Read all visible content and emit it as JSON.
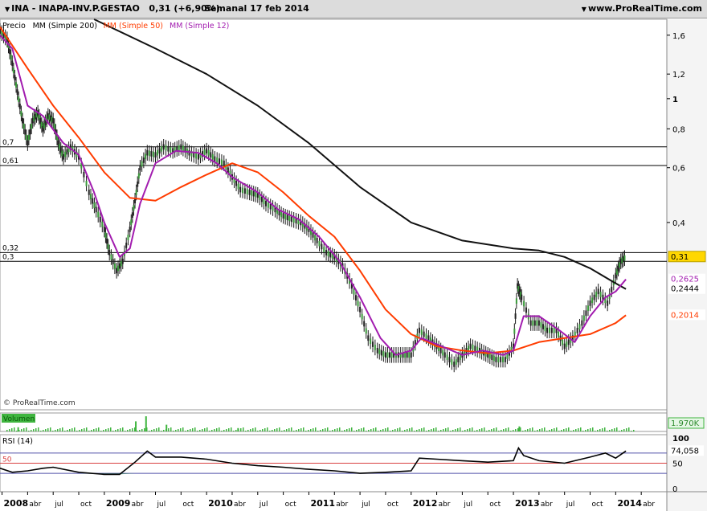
{
  "header": {
    "symbol": "INA - INAPA-INV.P.GESTAO",
    "price_change": "0,31 (+6,90%)",
    "period_date": "Semanal  17 feb 2014",
    "site": "www.ProRealTime.com"
  },
  "legend": {
    "price": "Precio",
    "ma200": "MM (Simple 200)",
    "ma50": "MM (Simple 50)",
    "ma12": "MM (Simple 12)"
  },
  "colors": {
    "price": "#1a1a1a",
    "ma200": "#111111",
    "ma50": "#ff3c00",
    "ma12": "#a21caf",
    "volume": "#3fb53f",
    "rsi_line": "#000000",
    "rsi_fill": "#1e7b3a",
    "level_line": "#000000",
    "rsi_mid": "#d94040",
    "rsi_band": "#5555aa",
    "badge_price": "#ffd700"
  },
  "watermark": "© ProRealTime.com",
  "chart_data": [
    {
      "type": "line",
      "title": "INA - INAPA-INV.P.GESTAO",
      "scale": "log",
      "ylim": [
        0.1,
        1.8
      ],
      "y_ticks": [
        "0,4",
        "0,6",
        "0,8",
        "1",
        "1,2",
        "1,6"
      ],
      "y_tick_values": [
        0.4,
        0.6,
        0.8,
        1.0,
        1.2,
        1.6
      ],
      "x": [
        "2008",
        "abr",
        "jul",
        "oct",
        "2009",
        "abr",
        "jul",
        "oct",
        "2010",
        "abr",
        "jul",
        "oct",
        "2011",
        "abr",
        "jul",
        "oct",
        "2012",
        "abr",
        "jul",
        "oct",
        "2013",
        "abr",
        "jul",
        "oct",
        "2014",
        "abr"
      ],
      "x_numeric": [
        2008.0,
        2008.25,
        2008.5,
        2008.75,
        2009.0,
        2009.25,
        2009.5,
        2009.75,
        2010.0,
        2010.25,
        2010.5,
        2010.75,
        2011.0,
        2011.25,
        2011.5,
        2011.75,
        2012.0,
        2012.25,
        2012.5,
        2012.75,
        2013.0,
        2013.25,
        2013.5,
        2013.75,
        2014.0,
        2014.25
      ],
      "xlim": [
        2007.98,
        2014.5
      ],
      "levels": [
        {
          "label": "0,7",
          "value": 0.7
        },
        {
          "label": "0,61",
          "value": 0.61
        },
        {
          "label": "0,32",
          "value": 0.32
        },
        {
          "label": "0,3",
          "value": 0.3
        }
      ],
      "series": [
        {
          "name": "Precio",
          "points": [
            [
              2007.98,
              1.65
            ],
            [
              2008.05,
              1.55
            ],
            [
              2008.1,
              1.3
            ],
            [
              2008.15,
              1.05
            ],
            [
              2008.2,
              0.85
            ],
            [
              2008.25,
              0.72
            ],
            [
              2008.3,
              0.85
            ],
            [
              2008.35,
              0.9
            ],
            [
              2008.4,
              0.8
            ],
            [
              2008.45,
              0.88
            ],
            [
              2008.5,
              0.85
            ],
            [
              2008.55,
              0.72
            ],
            [
              2008.6,
              0.65
            ],
            [
              2008.67,
              0.7
            ],
            [
              2008.75,
              0.65
            ],
            [
              2008.85,
              0.5
            ],
            [
              2008.92,
              0.44
            ],
            [
              2009.0,
              0.38
            ],
            [
              2009.05,
              0.32
            ],
            [
              2009.12,
              0.28
            ],
            [
              2009.18,
              0.3
            ],
            [
              2009.25,
              0.38
            ],
            [
              2009.3,
              0.47
            ],
            [
              2009.35,
              0.6
            ],
            [
              2009.42,
              0.67
            ],
            [
              2009.5,
              0.66
            ],
            [
              2009.58,
              0.7
            ],
            [
              2009.67,
              0.68
            ],
            [
              2009.75,
              0.7
            ],
            [
              2009.83,
              0.67
            ],
            [
              2009.92,
              0.65
            ],
            [
              2010.0,
              0.68
            ],
            [
              2010.08,
              0.64
            ],
            [
              2010.17,
              0.62
            ],
            [
              2010.25,
              0.56
            ],
            [
              2010.33,
              0.51
            ],
            [
              2010.42,
              0.5
            ],
            [
              2010.5,
              0.49
            ],
            [
              2010.58,
              0.46
            ],
            [
              2010.67,
              0.44
            ],
            [
              2010.75,
              0.42
            ],
            [
              2010.83,
              0.41
            ],
            [
              2010.92,
              0.4
            ],
            [
              2011.0,
              0.38
            ],
            [
              2011.08,
              0.35
            ],
            [
              2011.17,
              0.32
            ],
            [
              2011.25,
              0.31
            ],
            [
              2011.33,
              0.29
            ],
            [
              2011.42,
              0.25
            ],
            [
              2011.5,
              0.21
            ],
            [
              2011.58,
              0.17
            ],
            [
              2011.67,
              0.155
            ],
            [
              2011.75,
              0.15
            ],
            [
              2011.83,
              0.15
            ],
            [
              2011.92,
              0.15
            ],
            [
              2012.0,
              0.15
            ],
            [
              2012.08,
              0.18
            ],
            [
              2012.17,
              0.17
            ],
            [
              2012.25,
              0.16
            ],
            [
              2012.33,
              0.15
            ],
            [
              2012.42,
              0.14
            ],
            [
              2012.5,
              0.15
            ],
            [
              2012.58,
              0.16
            ],
            [
              2012.67,
              0.155
            ],
            [
              2012.75,
              0.15
            ],
            [
              2012.83,
              0.145
            ],
            [
              2012.92,
              0.145
            ],
            [
              2013.0,
              0.16
            ],
            [
              2013.04,
              0.25
            ],
            [
              2013.08,
              0.23
            ],
            [
              2013.17,
              0.19
            ],
            [
              2013.25,
              0.19
            ],
            [
              2013.33,
              0.18
            ],
            [
              2013.42,
              0.18
            ],
            [
              2013.5,
              0.16
            ],
            [
              2013.58,
              0.17
            ],
            [
              2013.67,
              0.19
            ],
            [
              2013.75,
              0.22
            ],
            [
              2013.83,
              0.24
            ],
            [
              2013.92,
              0.22
            ],
            [
              2014.0,
              0.27
            ],
            [
              2014.05,
              0.3
            ],
            [
              2014.1,
              0.31
            ]
          ]
        },
        {
          "name": "MM (Simple 200)",
          "points": [
            [
              2008.9,
              1.8
            ],
            [
              2009.5,
              1.45
            ],
            [
              2010.0,
              1.2
            ],
            [
              2010.5,
              0.95
            ],
            [
              2011.0,
              0.72
            ],
            [
              2011.5,
              0.52
            ],
            [
              2012.0,
              0.4
            ],
            [
              2012.5,
              0.35
            ],
            [
              2013.0,
              0.33
            ],
            [
              2013.25,
              0.325
            ],
            [
              2013.5,
              0.31
            ],
            [
              2013.75,
              0.285
            ],
            [
              2014.0,
              0.255
            ],
            [
              2014.1,
              0.2444
            ]
          ]
        },
        {
          "name": "MM (Simple 50)",
          "points": [
            [
              2007.98,
              1.7
            ],
            [
              2008.25,
              1.25
            ],
            [
              2008.5,
              0.95
            ],
            [
              2008.75,
              0.75
            ],
            [
              2009.0,
              0.58
            ],
            [
              2009.25,
              0.48
            ],
            [
              2009.5,
              0.47
            ],
            [
              2009.75,
              0.52
            ],
            [
              2010.0,
              0.57
            ],
            [
              2010.25,
              0.62
            ],
            [
              2010.5,
              0.58
            ],
            [
              2010.75,
              0.5
            ],
            [
              2011.0,
              0.42
            ],
            [
              2011.25,
              0.36
            ],
            [
              2011.5,
              0.28
            ],
            [
              2011.75,
              0.21
            ],
            [
              2012.0,
              0.175
            ],
            [
              2012.25,
              0.16
            ],
            [
              2012.5,
              0.155
            ],
            [
              2012.75,
              0.152
            ],
            [
              2013.0,
              0.155
            ],
            [
              2013.25,
              0.165
            ],
            [
              2013.5,
              0.17
            ],
            [
              2013.75,
              0.175
            ],
            [
              2014.0,
              0.19
            ],
            [
              2014.1,
              0.2014
            ]
          ]
        },
        {
          "name": "MM (Simple 12)",
          "points": [
            [
              2007.98,
              1.6
            ],
            [
              2008.1,
              1.45
            ],
            [
              2008.25,
              0.95
            ],
            [
              2008.4,
              0.88
            ],
            [
              2008.6,
              0.72
            ],
            [
              2008.75,
              0.66
            ],
            [
              2008.9,
              0.5
            ],
            [
              2009.0,
              0.4
            ],
            [
              2009.15,
              0.31
            ],
            [
              2009.25,
              0.33
            ],
            [
              2009.35,
              0.46
            ],
            [
              2009.5,
              0.62
            ],
            [
              2009.7,
              0.68
            ],
            [
              2009.92,
              0.67
            ],
            [
              2010.1,
              0.62
            ],
            [
              2010.25,
              0.56
            ],
            [
              2010.5,
              0.5
            ],
            [
              2010.7,
              0.44
            ],
            [
              2010.9,
              0.41
            ],
            [
              2011.1,
              0.36
            ],
            [
              2011.3,
              0.3
            ],
            [
              2011.5,
              0.23
            ],
            [
              2011.7,
              0.17
            ],
            [
              2011.85,
              0.15
            ],
            [
              2012.0,
              0.155
            ],
            [
              2012.1,
              0.17
            ],
            [
              2012.3,
              0.16
            ],
            [
              2012.5,
              0.15
            ],
            [
              2012.7,
              0.155
            ],
            [
              2012.9,
              0.15
            ],
            [
              2013.0,
              0.155
            ],
            [
              2013.1,
              0.2
            ],
            [
              2013.25,
              0.2
            ],
            [
              2013.45,
              0.18
            ],
            [
              2013.6,
              0.165
            ],
            [
              2013.75,
              0.2
            ],
            [
              2013.9,
              0.23
            ],
            [
              2014.0,
              0.24
            ],
            [
              2014.1,
              0.2625
            ]
          ]
        }
      ],
      "price_labels": [
        {
          "value": 0.31,
          "text": "0,31",
          "badge": "price"
        },
        {
          "value": 0.2625,
          "text": "0,2625",
          "badge": "ma12"
        },
        {
          "value": 0.2444,
          "text": "0,2444",
          "badge": "ma200"
        },
        {
          "value": 0.2014,
          "text": "0,2014",
          "badge": "ma50"
        }
      ]
    },
    {
      "type": "bar",
      "title": "Volumen",
      "last_value": "1.970K",
      "spike_fraction": [
        [
          2009.4,
          0.9
        ],
        [
          2009.3,
          0.6
        ],
        [
          2013.05,
          0.3
        ],
        [
          2008.15,
          0.25
        ],
        [
          2009.6,
          0.4
        ],
        [
          2010.3,
          0.2
        ]
      ]
    },
    {
      "type": "line",
      "title": "RSI (14)",
      "ylim": [
        0,
        100
      ],
      "y_ticks": [
        "100",
        "50",
        "0"
      ],
      "y_tick_values": [
        100,
        50,
        0
      ],
      "midline_label": "50",
      "midline": 50,
      "bands": [
        70,
        30
      ],
      "last_value": "74,058",
      "points": [
        [
          2007.98,
          40
        ],
        [
          2008.1,
          32
        ],
        [
          2008.25,
          35
        ],
        [
          2008.4,
          40
        ],
        [
          2008.5,
          42
        ],
        [
          2008.75,
          32
        ],
        [
          2009.0,
          28
        ],
        [
          2009.15,
          28
        ],
        [
          2009.3,
          52
        ],
        [
          2009.42,
          74
        ],
        [
          2009.5,
          62
        ],
        [
          2009.75,
          62
        ],
        [
          2010.0,
          58
        ],
        [
          2010.25,
          50
        ],
        [
          2010.5,
          45
        ],
        [
          2010.75,
          42
        ],
        [
          2011.0,
          38
        ],
        [
          2011.25,
          35
        ],
        [
          2011.5,
          30
        ],
        [
          2011.75,
          32
        ],
        [
          2012.0,
          35
        ],
        [
          2012.08,
          60
        ],
        [
          2012.25,
          58
        ],
        [
          2012.5,
          55
        ],
        [
          2012.75,
          52
        ],
        [
          2013.0,
          55
        ],
        [
          2013.05,
          80
        ],
        [
          2013.1,
          65
        ],
        [
          2013.25,
          55
        ],
        [
          2013.5,
          50
        ],
        [
          2013.75,
          62
        ],
        [
          2013.9,
          70
        ],
        [
          2014.0,
          60
        ],
        [
          2014.1,
          74.058
        ]
      ]
    }
  ]
}
